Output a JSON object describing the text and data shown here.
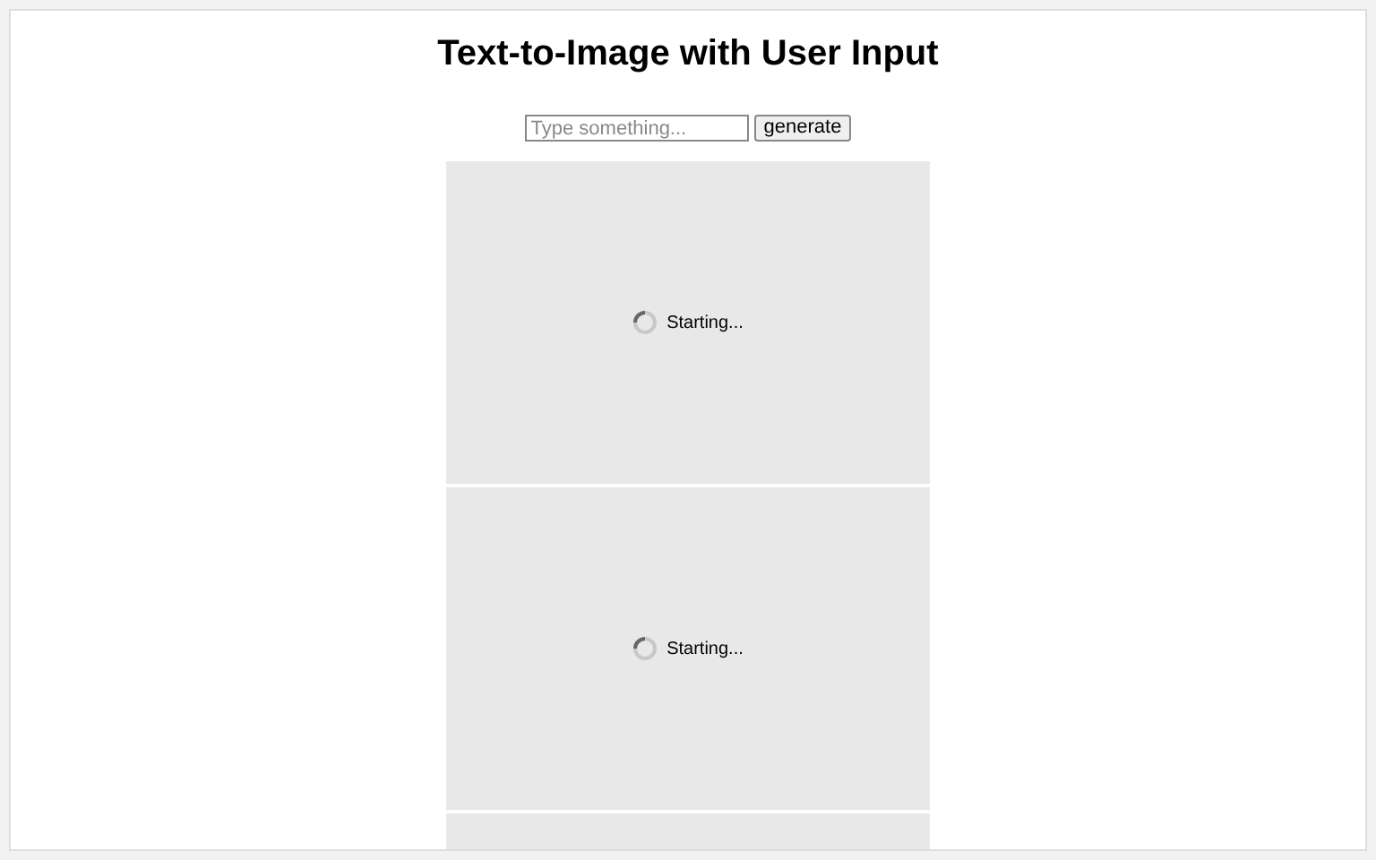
{
  "title": "Text-to-Image with User Input",
  "prompt": {
    "placeholder": "Type something..."
  },
  "button": "generate",
  "panels": [
    {
      "kind": "loading",
      "status": "Starting..."
    },
    {
      "kind": "loading",
      "status": "Starting..."
    },
    {
      "kind": "blank"
    }
  ]
}
